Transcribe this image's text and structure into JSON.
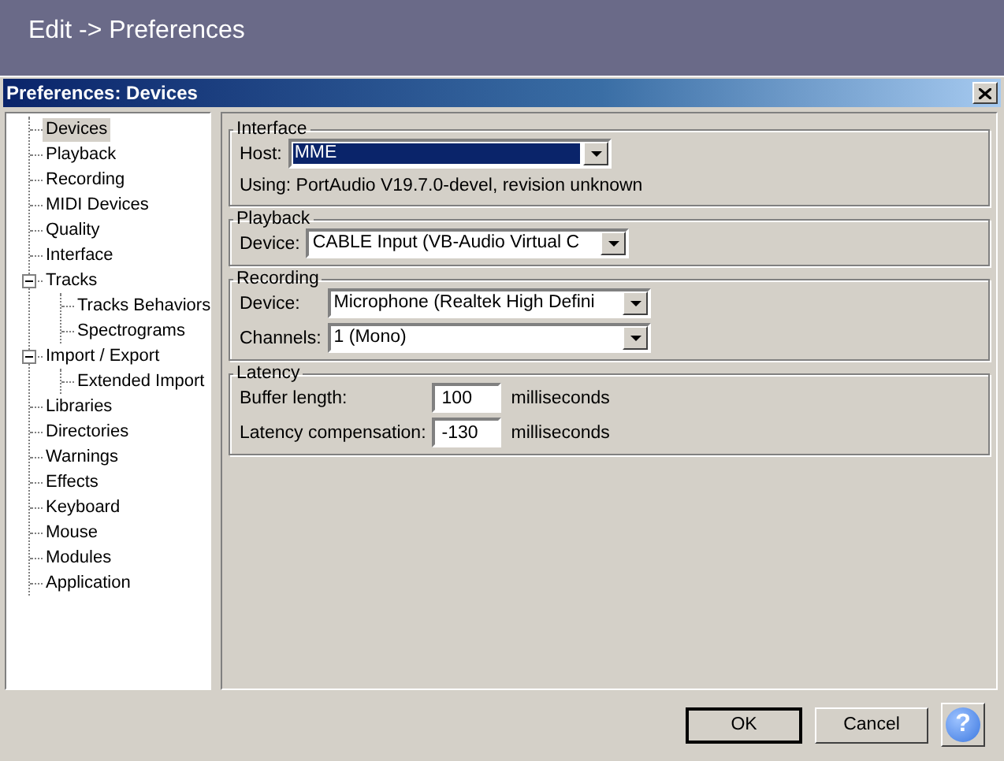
{
  "top_bar": {
    "title": "Edit -> Preferences"
  },
  "dialog": {
    "title": "Preferences: Devices"
  },
  "tree": [
    {
      "label": "Devices",
      "selected": true
    },
    {
      "label": "Playback",
      "selected": false
    },
    {
      "label": "Recording",
      "selected": false
    },
    {
      "label": "MIDI Devices",
      "selected": false
    },
    {
      "label": "Quality",
      "selected": false
    },
    {
      "label": "Interface",
      "selected": false
    },
    {
      "label": "Tracks",
      "selected": false,
      "expanded": true,
      "children": [
        {
          "label": "Tracks Behaviors",
          "selected": false
        },
        {
          "label": "Spectrograms",
          "selected": false
        }
      ]
    },
    {
      "label": "Import / Export",
      "selected": false,
      "expanded": true,
      "children": [
        {
          "label": "Extended Import",
          "selected": false
        }
      ]
    },
    {
      "label": "Libraries",
      "selected": false
    },
    {
      "label": "Directories",
      "selected": false
    },
    {
      "label": "Warnings",
      "selected": false
    },
    {
      "label": "Effects",
      "selected": false
    },
    {
      "label": "Keyboard",
      "selected": false
    },
    {
      "label": "Mouse",
      "selected": false
    },
    {
      "label": "Modules",
      "selected": false
    },
    {
      "label": "Application",
      "selected": false
    }
  ],
  "sections": [
    {
      "title": "Interface",
      "rows": [
        {
          "kind": "dropdown",
          "label": "Host:",
          "value": "MME",
          "focused": true
        },
        {
          "kind": "text",
          "text": "Using: PortAudio V19.7.0-devel, revision unknown"
        }
      ]
    },
    {
      "title": "Playback",
      "rows": [
        {
          "kind": "dropdown",
          "label": "Device:",
          "value": "CABLE Input (VB-Audio Virtual C",
          "focused": false
        }
      ]
    },
    {
      "title": "Recording",
      "rows": [
        {
          "kind": "dropdown",
          "label": "Device:",
          "value": "Microphone (Realtek High Defini",
          "focused": false
        },
        {
          "kind": "dropdown",
          "label": "Channels:",
          "value": "1 (Mono)",
          "focused": false
        }
      ]
    },
    {
      "title": "Latency",
      "rows": [
        {
          "kind": "number",
          "label": "Buffer length:",
          "value": "100",
          "unit": "milliseconds"
        },
        {
          "kind": "number",
          "label": "Latency compensation:",
          "value": "-130",
          "unit": "milliseconds"
        }
      ]
    }
  ],
  "buttons": [
    {
      "label": "OK",
      "default": true
    },
    {
      "label": "Cancel",
      "default": false
    }
  ],
  "help_button": {
    "label": "?"
  }
}
